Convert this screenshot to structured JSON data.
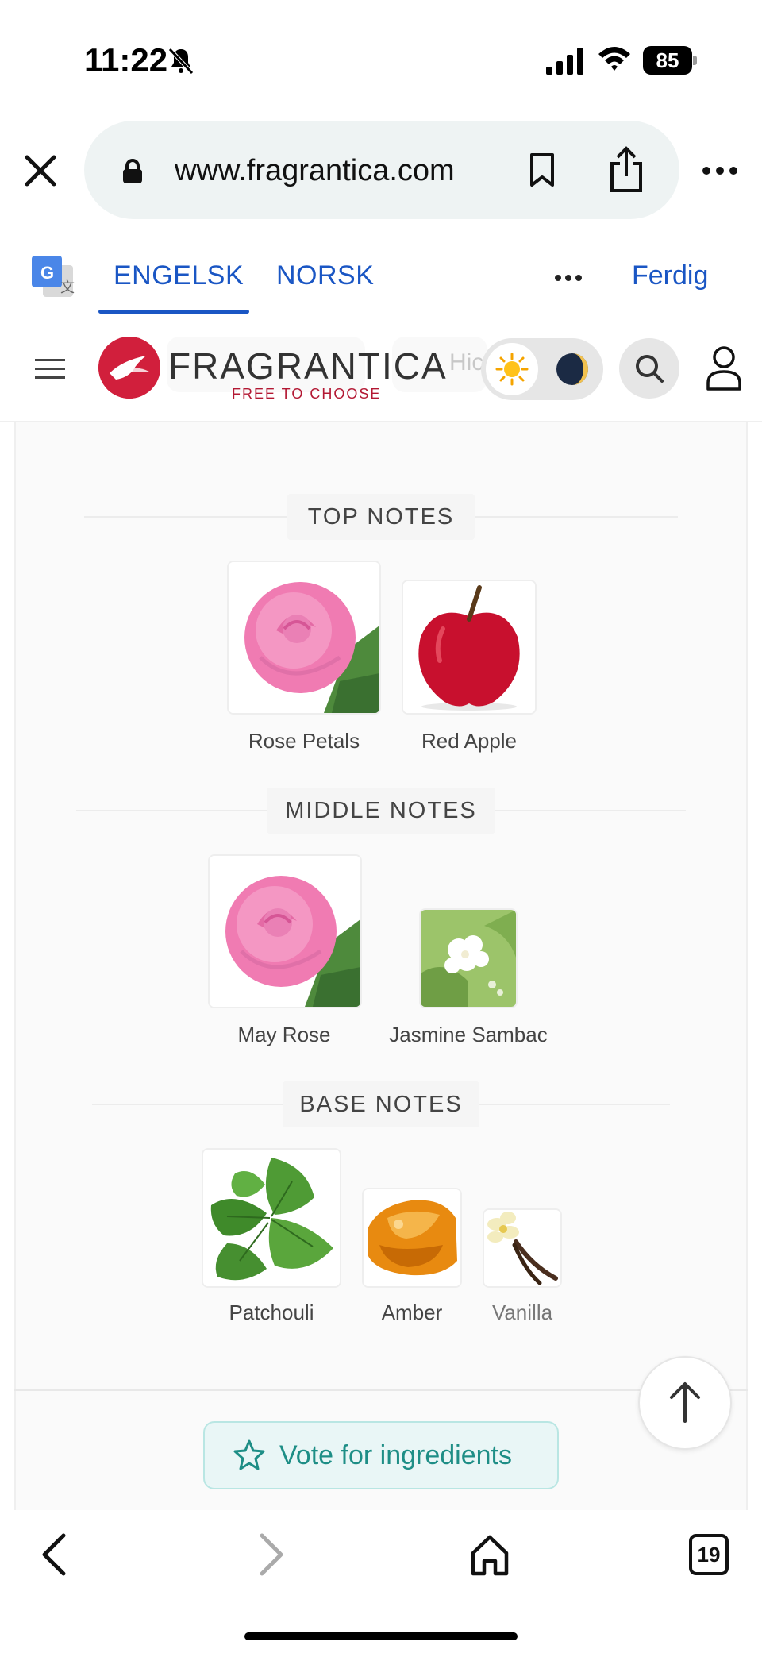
{
  "status_bar": {
    "time": "11:22",
    "battery": "85"
  },
  "browser": {
    "url": "www.fragrantica.com"
  },
  "translate": {
    "source_lang": "ENGELSK",
    "target_lang": "NORSK",
    "done_label": "Ferdig"
  },
  "site": {
    "logo_text": "FRAGRANTICA",
    "tagline": "FREE TO CHOOSE",
    "ghost_hint": "Hic"
  },
  "notes": {
    "top": {
      "title": "TOP NOTES",
      "items": [
        "Rose Petals",
        "Red Apple"
      ]
    },
    "middle": {
      "title": "MIDDLE NOTES",
      "items": [
        "May Rose",
        "Jasmine Sambac"
      ]
    },
    "base": {
      "title": "BASE NOTES",
      "items": [
        "Patchouli",
        "Amber",
        "Vanilla"
      ]
    }
  },
  "vote_label": "Vote for ingredients",
  "tabs_count": "19",
  "colors": {
    "accent_blue": "#1a56c4",
    "brand_red": "#d11f3c",
    "vote_teal": "#1e8e86"
  }
}
